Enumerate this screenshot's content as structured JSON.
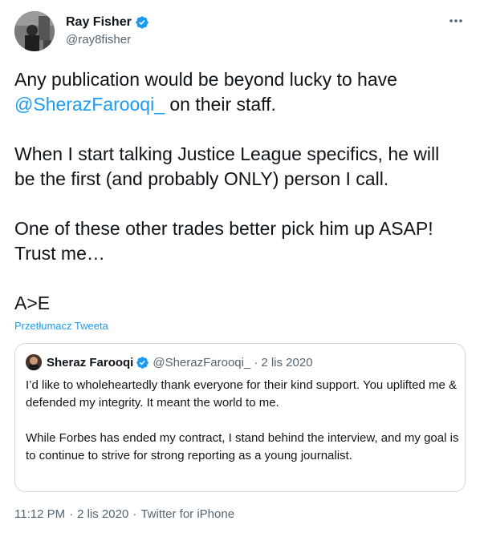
{
  "author": {
    "name": "Ray Fisher",
    "handle": "@ray8fisher"
  },
  "more_icon": "ellipsis-icon",
  "tweet": {
    "line1_prefix": "Any publication would be beyond lucky to have",
    "line2_mention": "@SherazFarooqi_",
    "line2_suffix": " on their staff.",
    "para2": "When I start talking Justice League specifics, he will be the first (and probably ONLY) person I call.",
    "para3": "One of these other trades better pick him up ASAP! Trust me…",
    "para4": "A>E"
  },
  "translate_label": "Przetłumacz Tweeta",
  "quote": {
    "name": "Sheraz Farooqi",
    "handle": "@SherazFarooqi_",
    "dot": "·",
    "date": "2 lis 2020",
    "para1": "I’d like to wholeheartedly thank everyone for their kind support. You uplifted me & defended my integrity. It meant the world to me.",
    "para2": "While Forbes has ended my contract, I stand behind the interview, and my goal is to continue to strive for strong reporting as a young journalist."
  },
  "meta": {
    "time": "11:12 PM",
    "sep1": "·",
    "date": "2 lis 2020",
    "sep2": "·",
    "source": "Twitter for iPhone"
  },
  "colors": {
    "accent": "#1d9bf0",
    "text": "#0f1419",
    "muted": "#536471",
    "border": "#cfd9de"
  }
}
